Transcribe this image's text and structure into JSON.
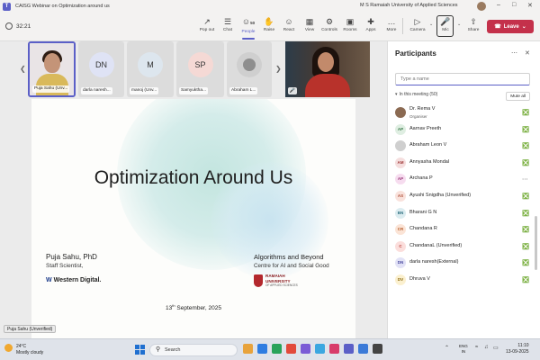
{
  "window": {
    "app_badge": "T",
    "title": "CAISG Webinar on Optimization around us",
    "org": "M S Ramaiah University of Applied Sciences",
    "controls": [
      "–",
      "□",
      "✕"
    ]
  },
  "toolbar": {
    "timer": "32:21",
    "people_count": "50",
    "items": [
      {
        "icon": "↗",
        "label": "Pop out"
      },
      {
        "icon": "☰",
        "label": "Chat"
      },
      {
        "icon": "☺",
        "label": "People"
      },
      {
        "icon": "✋",
        "label": "Raise"
      },
      {
        "icon": "☺",
        "label": "React"
      },
      {
        "icon": "▦",
        "label": "View"
      },
      {
        "icon": "⚙",
        "label": "Controls"
      },
      {
        "icon": "▣",
        "label": "Rooms"
      },
      {
        "icon": "✚",
        "label": "Apps"
      },
      {
        "icon": "…",
        "label": "More"
      }
    ],
    "camera_label": "Camera",
    "mic_label": "Mic",
    "share_label": "Share",
    "leave_label": "Leave"
  },
  "gallery": {
    "tiles": [
      {
        "initials": "",
        "name": "Puja Sahu (Unv...",
        "color": "#ffffff"
      },
      {
        "initials": "DN",
        "name": "darla naresh...",
        "color": "#dfe3f5"
      },
      {
        "initials": "M",
        "name": "manoj (Unv...",
        "color": "#dde6ee"
      },
      {
        "initials": "SP",
        "name": "Samyuktha...",
        "color": "#f5d9d5"
      },
      {
        "initials": "",
        "name": "Abraham L...",
        "color": "#ffffff"
      }
    ]
  },
  "slide": {
    "title": "Optimization Around Us",
    "speaker_name": "Puja Sahu, PhD",
    "speaker_role": "Staff Scientist,",
    "company": "Western Digital.",
    "series_title": "Algorithms and Beyond",
    "series_sub": "Centre for AI and Social Good",
    "university_line1": "RAMAIAH",
    "university_line2": "UNIVERSITY",
    "university_line3": "OF APPLIED SCIENCES",
    "date_day": "13",
    "date_suffix": "th",
    "date_rest": " September, 2025"
  },
  "presenter_tag": "Puja Sahu (Unverified)",
  "panel": {
    "title": "Participants",
    "search_placeholder": "Type a name",
    "section_title": "In this meeting (50)",
    "mute_all": "Mute all",
    "participants": [
      {
        "initials": "",
        "name": "Dr. Rema V",
        "role": "Organiser",
        "bg": "#8b6a52",
        "fg": "#ffffff",
        "status": "mic-off-icon"
      },
      {
        "initials": "AP",
        "name": "Aarnav Preeth",
        "role": "",
        "bg": "#dfeee2",
        "fg": "#3b7a4a",
        "status": "mic-off-icon"
      },
      {
        "initials": "",
        "name": "Abraham Leon V",
        "role": "",
        "bg": "#cfcfcf",
        "fg": "#444444",
        "status": "mic-off-icon"
      },
      {
        "initials": "AM",
        "name": "Annyasha Mondal",
        "role": "",
        "bg": "#f5dede",
        "fg": "#a03a3a",
        "status": "mic-off-icon"
      },
      {
        "initials": "AP",
        "name": "Archana P",
        "role": "",
        "bg": "#f6dcef",
        "fg": "#9a3a7a",
        "status": "more-icon"
      },
      {
        "initials": "AS",
        "name": "Ayushi Snigdha (Unverified)",
        "role": "",
        "bg": "#f9e2dc",
        "fg": "#b0503a",
        "status": "mic-off-icon"
      },
      {
        "initials": "BN",
        "name": "Bharani G N",
        "role": "",
        "bg": "#dcecf0",
        "fg": "#2f7080",
        "status": "mic-off-icon"
      },
      {
        "initials": "CR",
        "name": "Chandana R",
        "role": "",
        "bg": "#fbe4d6",
        "fg": "#b55a2a",
        "status": "mic-off-icon"
      },
      {
        "initials": "C",
        "name": "ChandanaL (Unverified)",
        "role": "",
        "bg": "#fbdedc",
        "fg": "#b83c36",
        "status": "mic-off-icon"
      },
      {
        "initials": "DN",
        "name": "darla naresh(External)",
        "role": "",
        "bg": "#e2e2f6",
        "fg": "#4a4aa0",
        "status": "mic-off-icon"
      },
      {
        "initials": "DV",
        "name": "Dhruva V",
        "role": "",
        "bg": "#fbf0cf",
        "fg": "#8a6a10",
        "status": "mic-off-icon"
      }
    ]
  },
  "taskbar": {
    "temp": "24°C",
    "weather": "Mostly cloudy",
    "search": "Search",
    "lang_1": "ENG",
    "lang_2": "IN",
    "time": "11:10",
    "date": "13-09-2025",
    "apps": [
      "#e8a33c",
      "#2f7de1",
      "#29a35a",
      "#e24a3b",
      "#7a5bd6",
      "#3ba7e0",
      "#d83b6a",
      "#5b5fc7",
      "#3b7ad8",
      "#444444"
    ]
  },
  "colors": {
    "accent": "#5b5fc7",
    "leave": "#c4314b"
  }
}
